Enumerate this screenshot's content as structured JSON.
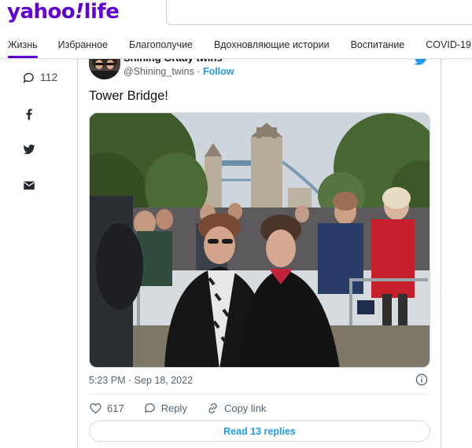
{
  "logo": {
    "yahoo": "yahoo",
    "bang": "!",
    "life": "life"
  },
  "search": {
    "placeholder": ""
  },
  "nav": {
    "items": [
      {
        "label": "Жизнь",
        "active": true
      },
      {
        "label": "Избранное"
      },
      {
        "label": "Благополучие"
      },
      {
        "label": "Вдохновляющие истории"
      },
      {
        "label": "Воспитание"
      },
      {
        "label": "COVID-19"
      }
    ]
  },
  "rail": {
    "comment_count": "112"
  },
  "tweet": {
    "author_name": "Shining Grady twins",
    "handle": "@Shining_twins",
    "separator": " · ",
    "follow_label": "Follow",
    "text": "Tower Bridge!",
    "timestamp": "5:23 PM · Sep 18, 2022",
    "like_count": "617",
    "reply_label": "Reply",
    "copy_label": "Copy link",
    "read_replies_label": "Read 13 replies"
  },
  "colors": {
    "brand": "#6001d2",
    "twitter_blue": "#1d9bf0"
  },
  "icons": [
    "comment-icon",
    "facebook-icon",
    "twitter-icon",
    "mail-icon",
    "twitter-bird-icon",
    "info-icon",
    "heart-icon",
    "reply-icon",
    "link-icon"
  ]
}
